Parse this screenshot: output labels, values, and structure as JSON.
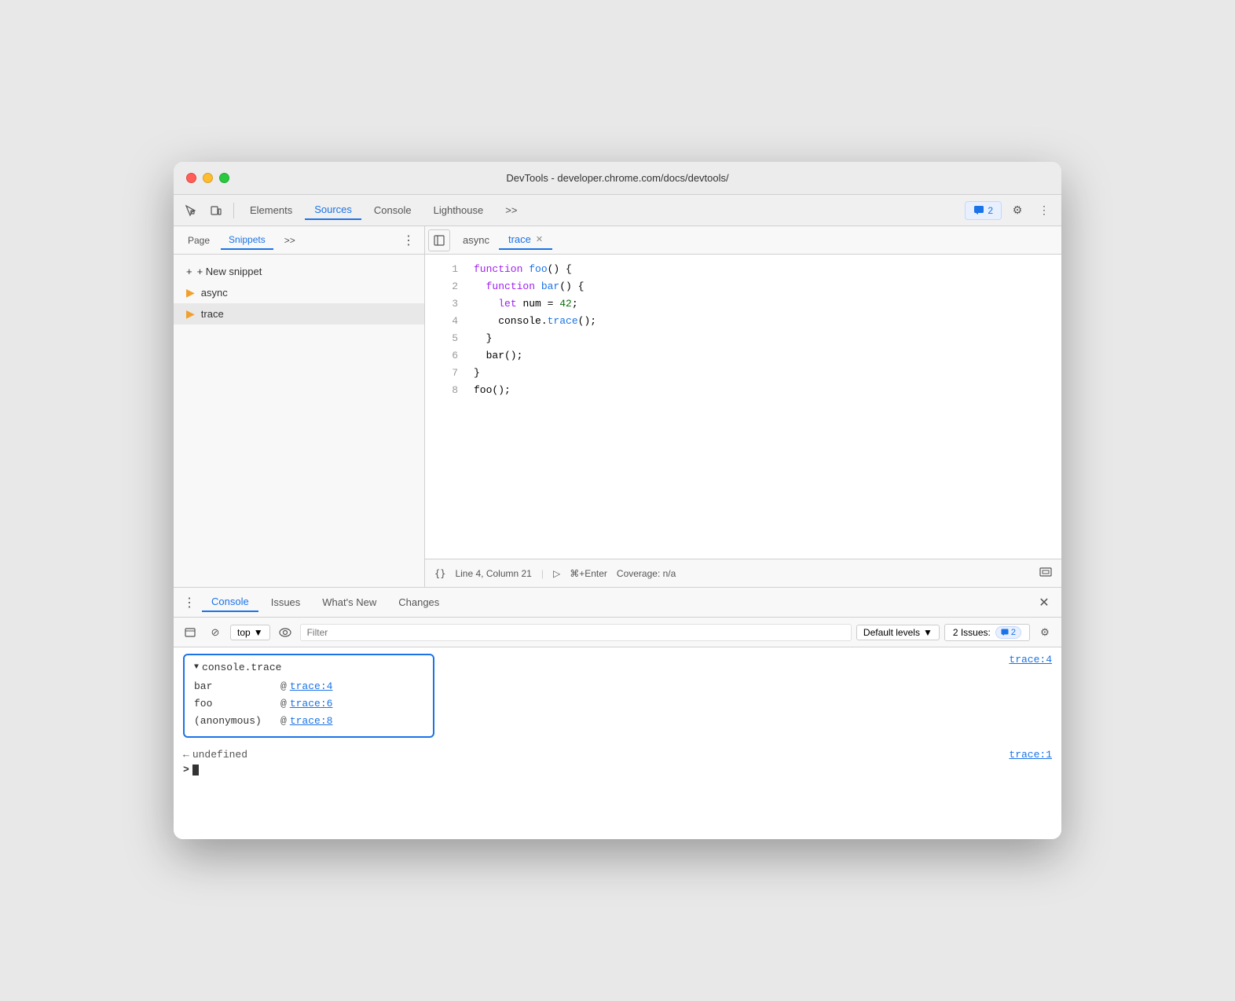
{
  "window": {
    "title": "DevTools - developer.chrome.com/docs/devtools/"
  },
  "toolbar": {
    "tabs": [
      {
        "id": "elements",
        "label": "Elements",
        "active": false
      },
      {
        "id": "sources",
        "label": "Sources",
        "active": true
      },
      {
        "id": "console",
        "label": "Console",
        "active": false
      },
      {
        "id": "lighthouse",
        "label": "Lighthouse",
        "active": false
      }
    ],
    "more_label": ">>",
    "issues_count": "2",
    "settings_icon": "⚙",
    "more_icon": "⋮"
  },
  "sidebar": {
    "tabs": [
      {
        "id": "page",
        "label": "Page",
        "active": false
      },
      {
        "id": "snippets",
        "label": "Snippets",
        "active": true
      }
    ],
    "more": ">>",
    "new_snippet_label": "+ New snippet",
    "items": [
      {
        "id": "async",
        "label": "async",
        "active": false
      },
      {
        "id": "trace",
        "label": "trace",
        "active": true
      }
    ]
  },
  "editor": {
    "tabs": [
      {
        "id": "async",
        "label": "async",
        "active": false,
        "closeable": false
      },
      {
        "id": "trace",
        "label": "trace",
        "active": true,
        "closeable": true
      }
    ],
    "code_lines": [
      {
        "num": "1",
        "content": "function foo() {",
        "parts": [
          {
            "text": "function ",
            "cls": "kw"
          },
          {
            "text": "foo",
            "cls": "fn"
          },
          {
            "text": "() {",
            "cls": ""
          }
        ]
      },
      {
        "num": "2",
        "content": "  function bar() {",
        "parts": [
          {
            "text": "  function ",
            "cls": "kw"
          },
          {
            "text": "bar",
            "cls": "fn"
          },
          {
            "text": "() {",
            "cls": ""
          }
        ]
      },
      {
        "num": "3",
        "content": "    let num = 42;",
        "parts": [
          {
            "text": "    ",
            "cls": ""
          },
          {
            "text": "let ",
            "cls": "kw"
          },
          {
            "text": "num",
            "cls": ""
          },
          {
            "text": " = ",
            "cls": ""
          },
          {
            "text": "42",
            "cls": "num"
          },
          {
            "text": ";",
            "cls": ""
          }
        ]
      },
      {
        "num": "4",
        "content": "    console.trace();",
        "parts": [
          {
            "text": "    console.",
            "cls": ""
          },
          {
            "text": "trace",
            "cls": "method"
          },
          {
            "text": "();",
            "cls": ""
          }
        ]
      },
      {
        "num": "5",
        "content": "  }",
        "parts": [
          {
            "text": "  }",
            "cls": ""
          }
        ]
      },
      {
        "num": "6",
        "content": "  bar();",
        "parts": [
          {
            "text": "  bar();",
            "cls": ""
          }
        ]
      },
      {
        "num": "7",
        "content": "}",
        "parts": [
          {
            "text": "}",
            "cls": ""
          }
        ]
      },
      {
        "num": "8",
        "content": "foo();",
        "parts": [
          {
            "text": "foo();",
            "cls": ""
          }
        ]
      }
    ],
    "statusbar": {
      "format_icon": "{}",
      "position": "Line 4, Column 21",
      "run_icon": "▷",
      "shortcut": "⌘+Enter",
      "coverage": "Coverage: n/a"
    }
  },
  "console_panel": {
    "tabs": [
      {
        "id": "console",
        "label": "Console",
        "active": true
      },
      {
        "id": "issues",
        "label": "Issues",
        "active": false
      },
      {
        "id": "whats_new",
        "label": "What's New",
        "active": false
      },
      {
        "id": "changes",
        "label": "Changes",
        "active": false
      }
    ],
    "toolbar": {
      "top_label": "top",
      "filter_placeholder": "Filter",
      "levels_label": "Default levels",
      "issues_label": "2 Issues:",
      "issues_count": "2"
    },
    "trace_group": {
      "header": "console.trace",
      "location": "trace:4",
      "rows": [
        {
          "fn": "bar",
          "at": "@",
          "link": "trace:4"
        },
        {
          "fn": "foo",
          "at": "@",
          "link": "trace:6"
        },
        {
          "fn": "(anonymous)",
          "at": "@",
          "link": "trace:8"
        }
      ]
    },
    "undefined_row": {
      "arrow": "←",
      "text": "undefined",
      "location": "trace:1"
    },
    "input_prompt": ">",
    "cursor": "|"
  }
}
